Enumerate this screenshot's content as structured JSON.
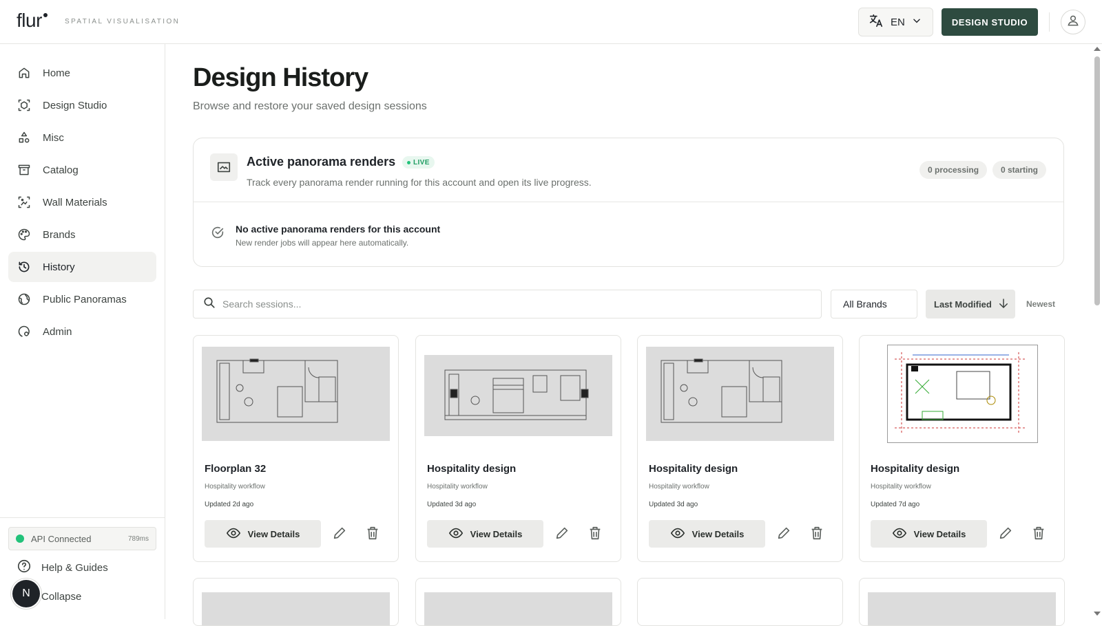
{
  "header": {
    "logo": "flur",
    "tagline": "SPATIAL VISUALISATION",
    "language": "EN",
    "design_studio_button": "DESIGN STUDIO"
  },
  "sidebar": {
    "items": [
      {
        "label": "Home",
        "icon": "home-icon"
      },
      {
        "label": "Design Studio",
        "icon": "cube-icon"
      },
      {
        "label": "Misc",
        "icon": "shapes-icon"
      },
      {
        "label": "Catalog",
        "icon": "archive-icon"
      },
      {
        "label": "Wall Materials",
        "icon": "wall-icon"
      },
      {
        "label": "Brands",
        "icon": "palette-icon"
      },
      {
        "label": "History",
        "icon": "history-icon",
        "active": true
      },
      {
        "label": "Public Panoramas",
        "icon": "globe-icon"
      },
      {
        "label": "Admin",
        "icon": "admin-icon"
      }
    ],
    "api_status": "API Connected",
    "api_latency": "789ms",
    "help": "Help & Guides",
    "collapse": "Collapse",
    "user_initial": "N"
  },
  "main": {
    "title": "Design History",
    "subtitle": "Browse and restore your saved design sessions",
    "renders": {
      "title": "Active panorama renders",
      "live_badge": "LIVE",
      "subtitle": "Track every panorama render running for this account and open its live progress.",
      "processing": "0 processing",
      "starting": "0 starting",
      "empty_title": "No active panorama renders for this account",
      "empty_subtitle": "New render jobs will appear here automatically."
    },
    "filters": {
      "search_placeholder": "Search sessions...",
      "brand": "All Brands",
      "sort": "Last Modified",
      "order": "Newest"
    },
    "sessions": [
      {
        "name": "Floorplan 32",
        "workflow": "Hospitality workflow",
        "updated": "Updated 2d ago",
        "view_label": "View Details"
      },
      {
        "name": "Hospitality design",
        "workflow": "Hospitality workflow",
        "updated": "Updated 3d ago",
        "view_label": "View Details"
      },
      {
        "name": "Hospitality design",
        "workflow": "Hospitality workflow",
        "updated": "Updated 3d ago",
        "view_label": "View Details"
      },
      {
        "name": "Hospitality design",
        "workflow": "Hospitality workflow",
        "updated": "Updated 7d ago",
        "view_label": "View Details"
      }
    ]
  },
  "colors": {
    "accent": "#2e4b40",
    "live": "#22c27a",
    "thumb_bg": "#dcdcdc"
  }
}
